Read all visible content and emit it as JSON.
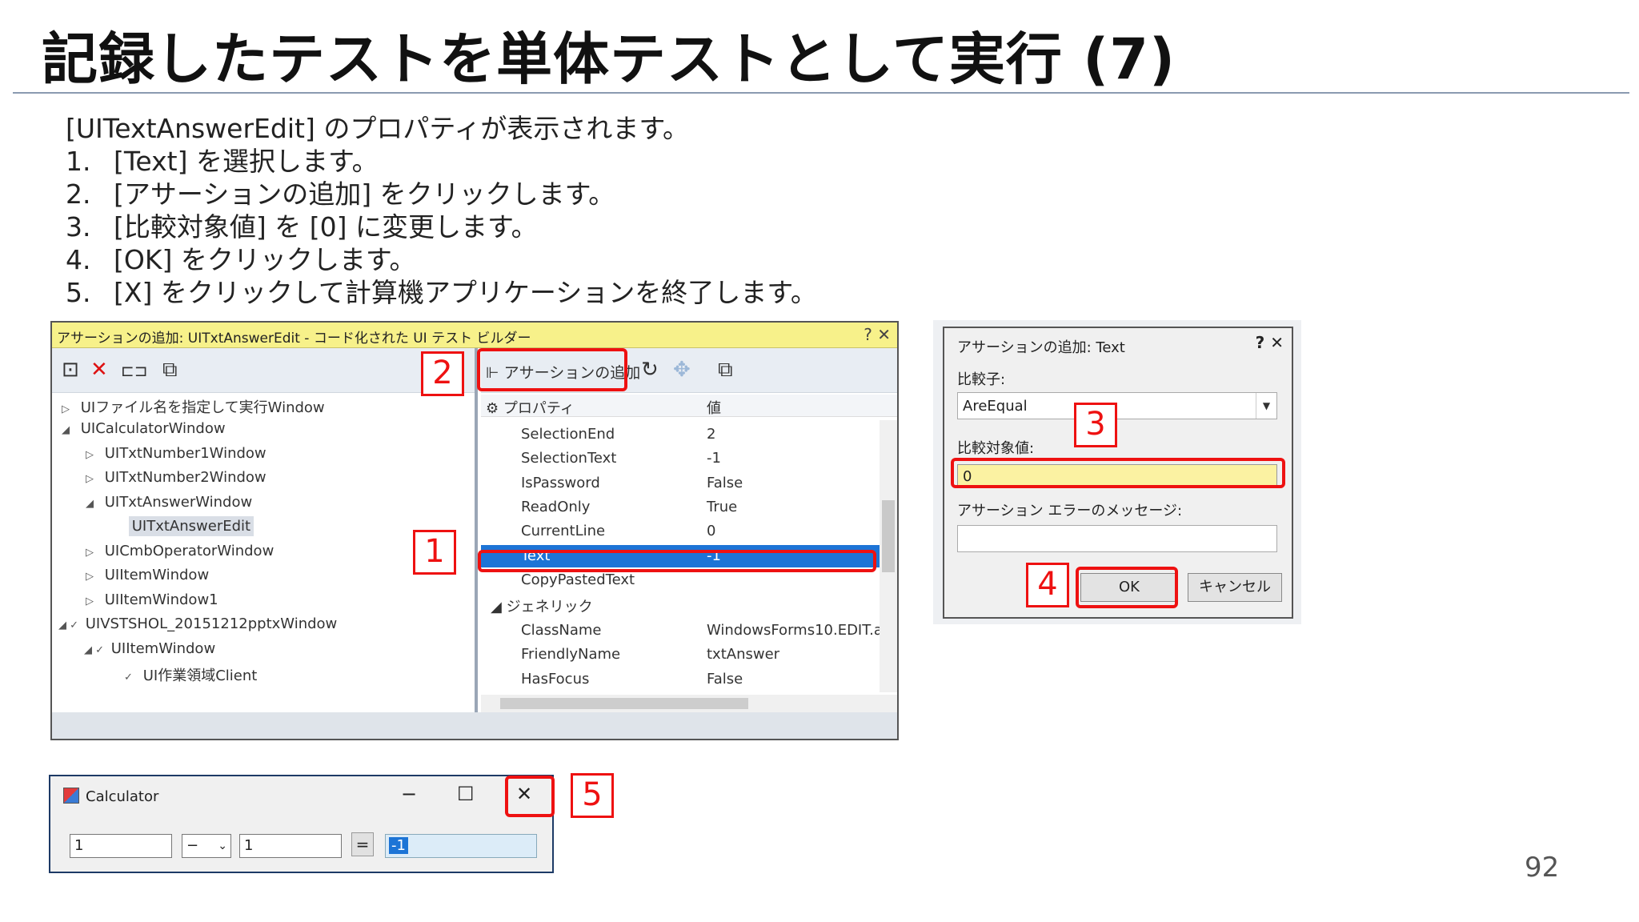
{
  "slide": {
    "title": "記録したテストを単体テストとして実行 (7)",
    "intro": "[UITextAnswerEdit] のプロパティが表示されます。",
    "steps": [
      {
        "num": "1.",
        "text": "[Text] を選択します。"
      },
      {
        "num": "2.",
        "text": "[アサーションの追加] をクリックします。"
      },
      {
        "num": "3.",
        "text": "[比較対象値] を [0] に変更します。"
      },
      {
        "num": "4.",
        "text": "[OK] をクリックします。"
      },
      {
        "num": "5.",
        "text": "[X] をクリックして計算機アプリケーションを終了します。"
      }
    ],
    "page_number": "92"
  },
  "builder": {
    "title": "アサーションの追加: UITxtAnswerEdit - コード化された UI テスト ビルダー",
    "title_controls": "? ✕",
    "add_assertion_label": "アサーションの追加",
    "tree": [
      {
        "arrow": "▷",
        "label": "UIファイル名を指定して実行Window"
      },
      {
        "arrow": "◢",
        "label": "UICalculatorWindow"
      },
      {
        "arrow": "▷",
        "label": "UITxtNumber1Window"
      },
      {
        "arrow": "▷",
        "label": "UITxtNumber2Window"
      },
      {
        "arrow": "◢",
        "label": "UITxtAnswerWindow"
      },
      {
        "arrow": "",
        "label": "UITxtAnswerEdit"
      },
      {
        "arrow": "▷",
        "label": "UICmbOperatorWindow"
      },
      {
        "arrow": "▷",
        "label": "UIItemWindow"
      },
      {
        "arrow": "▷",
        "label": "UIItemWindow1"
      },
      {
        "arrow": "◢ ✓",
        "label": "UIVSTSHOL_20151212pptxWindow"
      },
      {
        "arrow": "◢ ✓",
        "label": "UIItemWindow"
      },
      {
        "arrow": "✓",
        "label": "UI作業領域Client"
      }
    ],
    "prop_header": {
      "name": "プロパティ",
      "value": "値"
    },
    "properties": [
      {
        "name": "SelectionEnd",
        "value": "2"
      },
      {
        "name": "SelectionText",
        "value": "-1"
      },
      {
        "name": "IsPassword",
        "value": "False"
      },
      {
        "name": "ReadOnly",
        "value": "True"
      },
      {
        "name": "CurrentLine",
        "value": "0"
      },
      {
        "name": "Text",
        "value": "-1"
      },
      {
        "name": "CopyPastedText",
        "value": ""
      },
      {
        "name": "ジェネリック",
        "value": ""
      },
      {
        "name": "ClassName",
        "value": "WindowsForms10.EDIT.a"
      },
      {
        "name": "FriendlyName",
        "value": "txtAnswer"
      },
      {
        "name": "HasFocus",
        "value": "False"
      }
    ]
  },
  "dialog": {
    "title": "アサーションの追加: Text",
    "controls": "? ✕",
    "comparator_label": "比較子:",
    "comparator_value": "AreEqual",
    "compare_value_label": "比較対象値:",
    "compare_value": "0",
    "error_message_label": "アサーション エラーのメッセージ:",
    "ok_label": "OK",
    "cancel_label": "キャンセル"
  },
  "calculator": {
    "title": "Calculator",
    "minimize": "−",
    "maximize": "☐",
    "close": "✕",
    "number1": "1",
    "operator": "−",
    "number2": "1",
    "equals": "=",
    "answer": "-1"
  },
  "callouts": [
    "1",
    "2",
    "3",
    "4",
    "5"
  ]
}
